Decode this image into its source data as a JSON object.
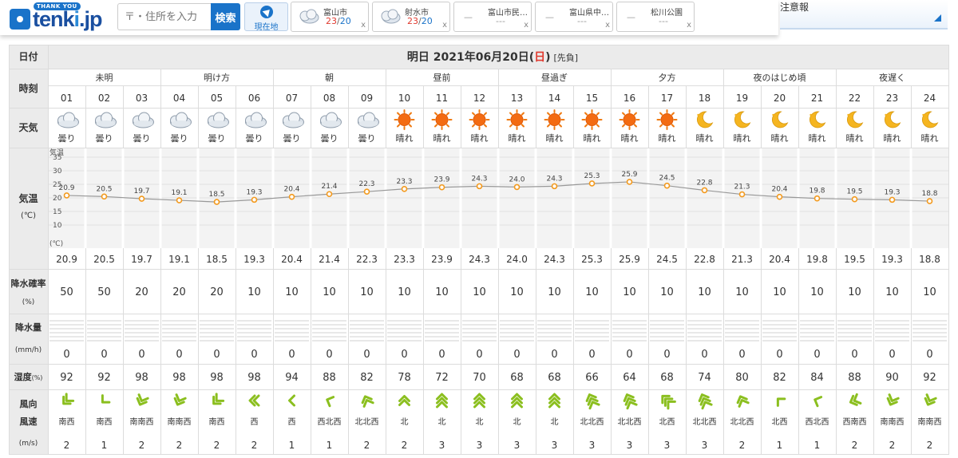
{
  "header": {
    "logo_thank": "THANK YOU",
    "logo_text_a": "tenk",
    "logo_text_b": "i",
    "logo_text_c": ".jp",
    "search_placeholder": "〒・住所を入力",
    "search_button": "検索",
    "location_button": "現在地",
    "places": [
      {
        "name": "富山市",
        "hi": "23",
        "lo": "20",
        "icon": "cloudy-icon"
      },
      {
        "name": "射水市",
        "hi": "23",
        "lo": "20",
        "icon": "cloudy-icon"
      },
      {
        "name": "富山市民…",
        "hi": "",
        "lo": "",
        "icon": ""
      },
      {
        "name": "富山県中…",
        "hi": "",
        "lo": "",
        "icon": ""
      },
      {
        "name": "松川公園",
        "hi": "",
        "lo": "",
        "icon": ""
      }
    ],
    "place_dash": "—",
    "place_empty_temp": "---",
    "close_label": "x",
    "alert_label": "注意報"
  },
  "table": {
    "labels": {
      "date": "日付",
      "time": "時刻",
      "weather": "天気",
      "temp": "気温",
      "temp_unit": "(℃)",
      "precip_prob": "降水確率",
      "precip_prob_unit": "(%)",
      "precip_amt": "降水量",
      "precip_amt_unit": "(mm/h)",
      "humidity": "湿度",
      "humidity_unit": "(%)",
      "wind_dir": "風向",
      "wind_speed": "風速",
      "wind_unit": "(m/s)"
    },
    "date_prefix": "明日 2021年06月20日(",
    "date_day": "日",
    "date_suffix": ")",
    "date_rokuyo": "[先負]",
    "periods": [
      "未明",
      "明け方",
      "朝",
      "昼前",
      "昼過ぎ",
      "夕方",
      "夜のはじめ頃",
      "夜遅く"
    ],
    "hours": [
      "01",
      "02",
      "03",
      "04",
      "05",
      "06",
      "07",
      "08",
      "09",
      "10",
      "11",
      "12",
      "13",
      "14",
      "15",
      "16",
      "17",
      "18",
      "19",
      "20",
      "21",
      "22",
      "23",
      "24"
    ],
    "weather": [
      "曇り",
      "曇り",
      "曇り",
      "曇り",
      "曇り",
      "曇り",
      "曇り",
      "曇り",
      "曇り",
      "晴れ",
      "晴れ",
      "晴れ",
      "晴れ",
      "晴れ",
      "晴れ",
      "晴れ",
      "晴れ",
      "晴れ",
      "晴れ",
      "晴れ",
      "晴れ",
      "晴れ",
      "晴れ",
      "晴れ"
    ],
    "weather_icons": [
      "cloud",
      "cloud",
      "cloud",
      "cloud",
      "cloud",
      "cloud",
      "cloud",
      "cloud",
      "cloud",
      "sun",
      "sun",
      "sun",
      "sun",
      "sun",
      "sun",
      "sun",
      "sun",
      "moon",
      "moon",
      "moon",
      "moon",
      "moon",
      "moon",
      "moon"
    ],
    "temps": [
      "20.9",
      "20.5",
      "19.7",
      "19.1",
      "18.5",
      "19.3",
      "20.4",
      "21.4",
      "22.3",
      "23.3",
      "23.9",
      "24.3",
      "24.0",
      "24.3",
      "25.3",
      "25.9",
      "24.5",
      "22.8",
      "21.3",
      "20.4",
      "19.8",
      "19.5",
      "19.3",
      "18.8"
    ],
    "precip_prob": [
      "50",
      "50",
      "20",
      "20",
      "20",
      "10",
      "10",
      "10",
      "10",
      "10",
      "10",
      "10",
      "10",
      "10",
      "10",
      "10",
      "10",
      "10",
      "10",
      "10",
      "10",
      "10",
      "10",
      "10"
    ],
    "precip_amt": [
      "0",
      "0",
      "0",
      "0",
      "0",
      "0",
      "0",
      "0",
      "0",
      "0",
      "0",
      "0",
      "0",
      "0",
      "0",
      "0",
      "0",
      "0",
      "0",
      "0",
      "0",
      "0",
      "0",
      "0"
    ],
    "humidity": [
      "92",
      "92",
      "98",
      "98",
      "98",
      "98",
      "94",
      "88",
      "82",
      "78",
      "72",
      "70",
      "68",
      "68",
      "66",
      "64",
      "68",
      "74",
      "80",
      "82",
      "84",
      "88",
      "90",
      "92"
    ],
    "wind_dir": [
      "南西",
      "南西",
      "南南西",
      "南南西",
      "南西",
      "西",
      "西",
      "西北西",
      "北北西",
      "北",
      "北",
      "北",
      "北",
      "北",
      "北北西",
      "北北西",
      "北西",
      "北北西",
      "北北西",
      "北西",
      "西北西",
      "西南西",
      "南南西",
      "南南西"
    ],
    "wind_speed": [
      "2",
      "1",
      "2",
      "2",
      "2",
      "2",
      "1",
      "1",
      "2",
      "2",
      "3",
      "3",
      "3",
      "3",
      "3",
      "3",
      "3",
      "3",
      "2",
      "1",
      "1",
      "2",
      "2",
      "2"
    ],
    "colors": {
      "label_bg": "#ebebeb",
      "hi": "#e03a2f",
      "lo": "#1a73c9",
      "line": "#999999",
      "point": "#f39a1e",
      "wind": "#8bbf1f",
      "grid": "#dcdcdc"
    }
  },
  "chart_data": {
    "type": "line",
    "title": "",
    "xlabel": "",
    "ylabel": "気温",
    "yaxis_title": "気温",
    "yaxis_unit": "(℃)",
    "x": [
      "01",
      "02",
      "03",
      "04",
      "05",
      "06",
      "07",
      "08",
      "09",
      "10",
      "11",
      "12",
      "13",
      "14",
      "15",
      "16",
      "17",
      "18",
      "19",
      "20",
      "21",
      "22",
      "23",
      "24"
    ],
    "series": [
      {
        "values": [
          20.9,
          20.5,
          19.7,
          19.1,
          18.5,
          19.3,
          20.4,
          21.4,
          22.3,
          23.3,
          23.9,
          24.3,
          24.0,
          24.3,
          25.3,
          25.9,
          24.5,
          22.8,
          21.3,
          20.4,
          19.8,
          19.5,
          19.3,
          18.8
        ]
      }
    ],
    "yticks": [
      "35",
      "30",
      "25",
      "20",
      "15",
      "10"
    ],
    "ylim": [
      5,
      35
    ],
    "grid": true
  }
}
